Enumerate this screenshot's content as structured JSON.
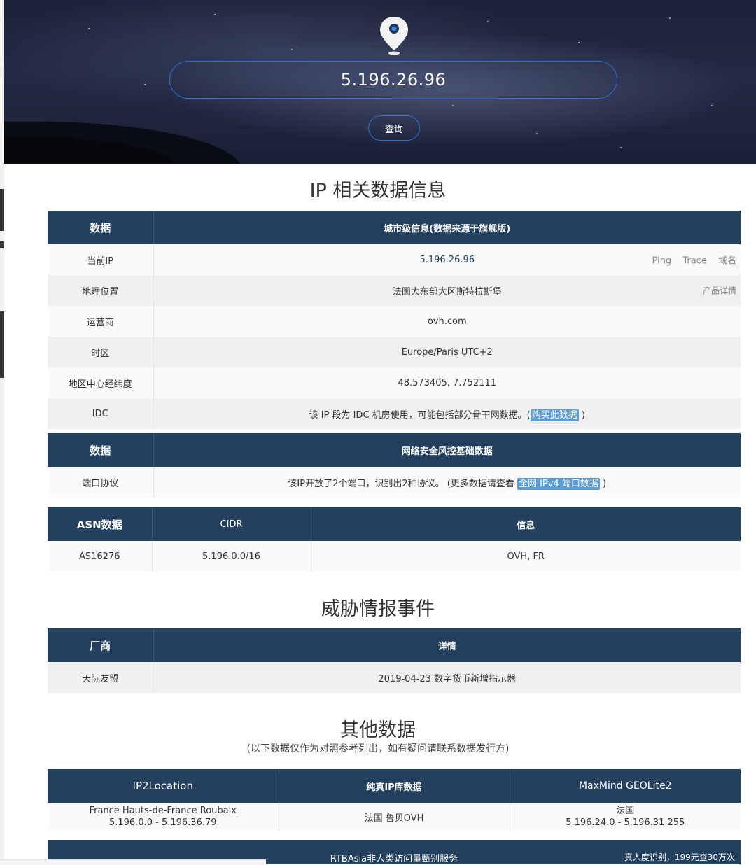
{
  "search": {
    "ip_value": "5.196.26.96",
    "query_button": "查询"
  },
  "section1": {
    "title": "IP 相关数据信息",
    "header_left": "数据",
    "header_right": "城市级信息(数据来源于旗舰版)",
    "rows": [
      {
        "label": "当前IP",
        "value": "5.196.26.96"
      },
      {
        "label": "地理位置",
        "value": "法国大东部大区斯特拉斯堡"
      },
      {
        "label": "运营商",
        "value": "ovh.com"
      },
      {
        "label": "时区",
        "value": "Europe/Paris UTC+2"
      },
      {
        "label": "地区中心经纬度",
        "value": "48.573405, 7.752111"
      },
      {
        "label": "IDC",
        "value": "该 IP 段为 IDC 机房使用，可能包括部分骨干网数据。(",
        "link": "购买此数据",
        "suffix": " )"
      }
    ],
    "row0_links": [
      "Ping",
      "Trace",
      "域名"
    ],
    "row1_link": "产品详情"
  },
  "section_security": {
    "header_left": "数据",
    "header_right": "网络安全风控基础数据",
    "row_label": "端口协议",
    "row_text": "该IP开放了2个端口，识别出2种协议。 (更多数据请查看 ",
    "row_link": "全网 IPv4 端口数据",
    "row_suffix": " )"
  },
  "asn": {
    "headers": [
      "ASN数据",
      "CIDR",
      "信息"
    ],
    "row": [
      "AS16276",
      "5.196.0.0/16",
      "OVH, FR"
    ]
  },
  "threat": {
    "title": "威胁情报事件",
    "headers": [
      "厂商",
      "详情"
    ],
    "row": [
      "天际友盟",
      "2019-04-23 数字货币新增指示器"
    ]
  },
  "other": {
    "title": "其他数据",
    "note": "(以下数据仅作为对照参考列出，如有疑问请联系数据发行方)",
    "headers": [
      "IP2Location",
      "纯真IP库数据",
      "MaxMind GEOLite2"
    ],
    "cells": [
      {
        "line1": "France Hauts-de-France Roubaix",
        "line2": "5.196.0.0 - 5.196.36.79"
      },
      {
        "line1": "法国 鲁贝OVH",
        "line2": ""
      },
      {
        "line1": "法国",
        "line2": "5.196.24.0 - 5.196.31.255"
      }
    ]
  },
  "rtb": {
    "center": "RTBAsia非人类访问量甄别服务",
    "right": "真人度识别，199元查30万次"
  }
}
